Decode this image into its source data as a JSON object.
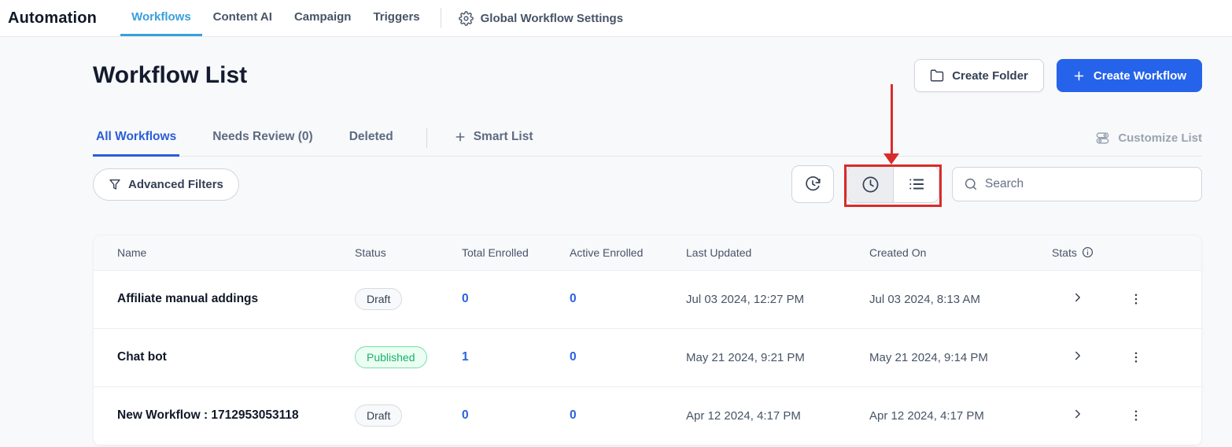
{
  "colors": {
    "primary_blue": "#2563eb",
    "nav_active_blue": "#38a0db",
    "tab_active_blue": "#2b5cd9",
    "link_blue": "#2b61e0",
    "published_green": "#17b26a",
    "published_bg": "#ecfdf3",
    "published_border": "#75e0a7",
    "draft_text": "#344054",
    "annotation_red": "#d92b2b"
  },
  "topnav": {
    "brand": "Automation",
    "tabs": [
      {
        "label": "Workflows",
        "active": true
      },
      {
        "label": "Content AI",
        "active": false
      },
      {
        "label": "Campaign",
        "active": false
      },
      {
        "label": "Triggers",
        "active": false
      }
    ],
    "settings_label": "Global Workflow Settings"
  },
  "page": {
    "title": "Workflow List",
    "create_folder_label": "Create Folder",
    "create_workflow_label": "Create Workflow",
    "customize_list_label": "Customize List"
  },
  "list_tabs": [
    {
      "label": "All Workflows",
      "active": true
    },
    {
      "label": "Needs Review (0)",
      "active": false
    },
    {
      "label": "Deleted",
      "active": false
    },
    {
      "label": "Smart List",
      "active": false
    }
  ],
  "toolbar": {
    "advanced_filters_label": "Advanced Filters",
    "search_placeholder": "Search"
  },
  "icons": {
    "gear-icon": "settings cog",
    "folder-icon": "folder outline",
    "plus-icon": "plus",
    "filter-icon": "funnel",
    "history-icon": "clock with clockwise arrow",
    "clock-icon": "clock",
    "list-view-icon": "bulleted list",
    "search-icon": "magnifier",
    "customize-icon": "double slider toggles",
    "info-icon": "circled i",
    "chevron-right-icon": "right chevron",
    "kebab-icon": "three vertical dots"
  },
  "annotation": {
    "description": "red arrow pointing down to red-outlined view toggle button group (clock view / list view)"
  },
  "table": {
    "columns": [
      "Name",
      "Status",
      "Total Enrolled",
      "Active Enrolled",
      "Last Updated",
      "Created On",
      "Stats"
    ],
    "rows": [
      {
        "name": "Affiliate manual addings",
        "status": "Draft",
        "status_type": "draft",
        "total_enrolled": "0",
        "active_enrolled": "0",
        "last_updated": "Jul 03 2024, 12:27 PM",
        "created_on": "Jul 03 2024, 8:13 AM"
      },
      {
        "name": "Chat bot",
        "status": "Published",
        "status_type": "published",
        "total_enrolled": "1",
        "active_enrolled": "0",
        "last_updated": "May 21 2024, 9:21 PM",
        "created_on": "May 21 2024, 9:14 PM"
      },
      {
        "name": "New Workflow : 1712953053118",
        "status": "Draft",
        "status_type": "draft",
        "total_enrolled": "0",
        "active_enrolled": "0",
        "last_updated": "Apr 12 2024, 4:17 PM",
        "created_on": "Apr 12 2024, 4:17 PM"
      }
    ]
  }
}
